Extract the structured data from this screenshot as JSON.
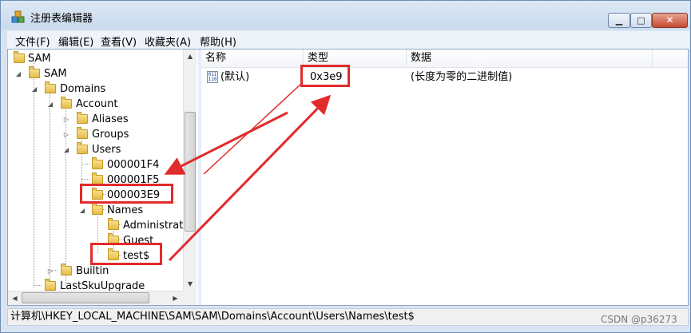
{
  "window": {
    "title": "注册表编辑器",
    "buttons": {
      "minimize": "▁",
      "maximize": "□",
      "close": "✕"
    }
  },
  "menu": [
    "文件(F)",
    "编辑(E)",
    "查看(V)",
    "收藏夹(A)",
    "帮助(H)"
  ],
  "tree": {
    "nodes": [
      "SAM",
      "SAM",
      "Domains",
      "Account",
      "Aliases",
      "Groups",
      "Users",
      "000001F4",
      "000001F5",
      "000003E9",
      "Names",
      "Administrat",
      "Guest",
      "test$",
      "Builtin",
      "LastSkuUpgrade"
    ]
  },
  "list": {
    "columns": [
      "名称",
      "类型",
      "数据"
    ],
    "rows": [
      {
        "name": "(默认)",
        "type": "0x3e9",
        "data": "(长度为零的二进制值)"
      }
    ]
  },
  "status": {
    "path": "计算机\\HKEY_LOCAL_MACHINE\\SAM\\SAM\\Domains\\Account\\Users\\Names\\test$"
  },
  "watermark": "CSDN @p36273",
  "colors": {
    "highlight": "#e22b2b",
    "titlebar": "#cbdcef"
  }
}
